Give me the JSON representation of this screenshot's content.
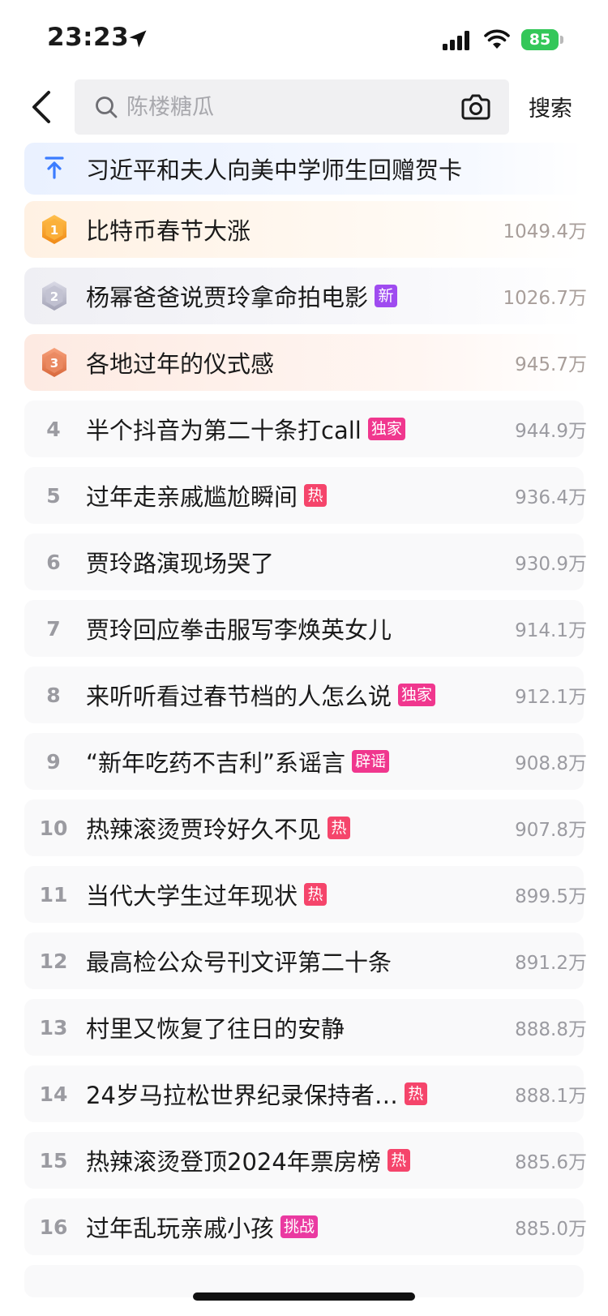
{
  "status_bar": {
    "time": "23:23",
    "battery": "85",
    "icons": [
      "location-arrow-icon",
      "signal-icon",
      "wifi-icon",
      "battery-icon"
    ]
  },
  "header": {
    "back_icon": "chevron-left-icon",
    "search_placeholder": "陈楼糖瓜",
    "search_value": "",
    "camera_icon": "camera-icon",
    "search_button_label": "搜索"
  },
  "pinned": {
    "icon": "pin-top-icon",
    "title": "习近平和夫人向美中学师生回赠贺卡"
  },
  "hot_list": [
    {
      "rank": "1",
      "title": "比特币春节大涨",
      "badge": "",
      "count": "1049.4万"
    },
    {
      "rank": "2",
      "title": "杨幂爸爸说贾玲拿命拍电影",
      "badge": "新",
      "count": "1026.7万"
    },
    {
      "rank": "3",
      "title": "各地过年的仪式感",
      "badge": "",
      "count": "945.7万"
    },
    {
      "rank": "4",
      "title": "半个抖音为第二十条打call",
      "badge": "独家",
      "count": "944.9万"
    },
    {
      "rank": "5",
      "title": "过年走亲戚尴尬瞬间",
      "badge": "热",
      "count": "936.4万"
    },
    {
      "rank": "6",
      "title": "贾玲路演现场哭了",
      "badge": "",
      "count": "930.9万"
    },
    {
      "rank": "7",
      "title": "贾玲回应拳击服写李焕英女儿",
      "badge": "",
      "count": "914.1万"
    },
    {
      "rank": "8",
      "title": "来听听看过春节档的人怎么说",
      "badge": "独家",
      "count": "912.1万"
    },
    {
      "rank": "9",
      "title": "“新年吃药不吉利”系谣言",
      "badge": "辟谣",
      "count": "908.8万"
    },
    {
      "rank": "10",
      "title": "热辣滚烫贾玲好久不见",
      "badge": "热",
      "count": "907.8万"
    },
    {
      "rank": "11",
      "title": "当代大学生过年现状",
      "badge": "热",
      "count": "899.5万"
    },
    {
      "rank": "12",
      "title": "最高检公众号刊文评第二十条",
      "badge": "",
      "count": "891.2万"
    },
    {
      "rank": "13",
      "title": "村里又恢复了往日的安静",
      "badge": "",
      "count": "888.8万"
    },
    {
      "rank": "14",
      "title": "24岁马拉松世界纪录保持者…",
      "badge": "热",
      "count": "888.1万"
    },
    {
      "rank": "15",
      "title": "热辣滚烫登顶2024年票房榜",
      "badge": "热",
      "count": "885.6万"
    },
    {
      "rank": "16",
      "title": "过年乱玩亲戚小孩",
      "badge": "挑战",
      "count": "885.0万"
    }
  ],
  "colors": {
    "hot_badge": "#f5456b",
    "new_badge": "#9f4bf0",
    "exclusive_badge": "#f0378e",
    "rumor_badge": "#f0378e",
    "challenge_badge": "#ea3aa1",
    "medal_gold": "#f5a623",
    "medal_silver": "#b8b8c8",
    "medal_bronze": "#e8825a",
    "pin_blue": "#3b7cff",
    "battery_green": "#34c759"
  }
}
